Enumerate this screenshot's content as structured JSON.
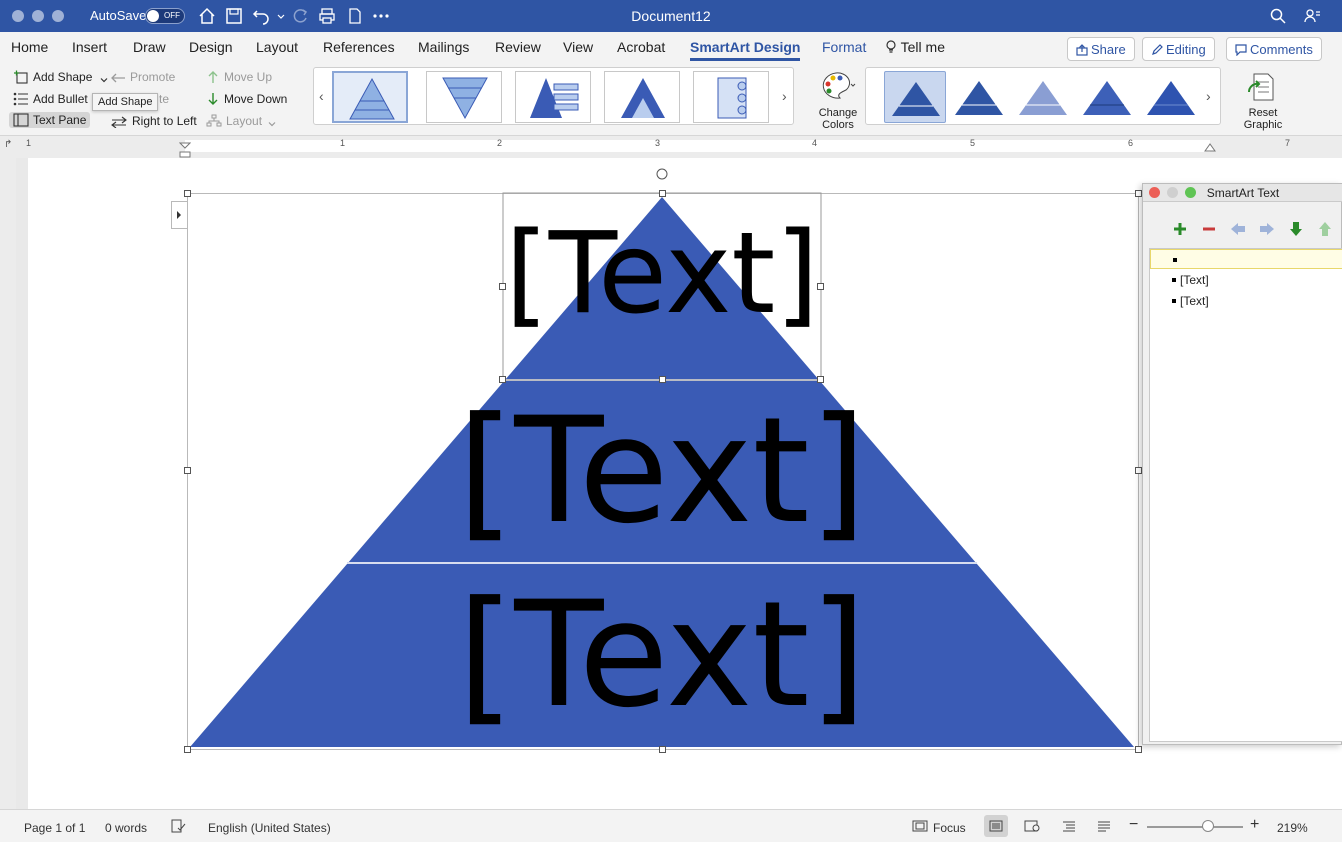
{
  "titlebar": {
    "autosave_label": "AutoSave",
    "autosave_state": "OFF",
    "document_title": "Document12"
  },
  "tabs": [
    "Home",
    "Insert",
    "Draw",
    "Design",
    "Layout",
    "References",
    "Mailings",
    "Review",
    "View",
    "Acrobat",
    "SmartArt Design",
    "Format"
  ],
  "tell_me": "Tell me",
  "buttons": {
    "share": "Share",
    "editing": "Editing",
    "comments": "Comments"
  },
  "ribbon": {
    "add_shape": "Add Shape",
    "add_bullet": "Add Bullet",
    "text_pane": "Text Pane",
    "promote": "Promote",
    "demote_fragment": "te",
    "right_to_left": "Right to Left",
    "move_up": "Move Up",
    "move_down": "Move Down",
    "layout": "Layout",
    "change_colors": "Change Colors",
    "change_colors_line1": "Change",
    "change_colors_line2": "Colors",
    "reset_graphic_line1": "Reset",
    "reset_graphic_line2": "Graphic",
    "tooltip": "Add Shape"
  },
  "ruler": {
    "numbers": [
      "1",
      "1",
      "2",
      "3",
      "4",
      "5",
      "6",
      "7"
    ]
  },
  "smartart": {
    "shapes": [
      "[Text]",
      "[Text]",
      "[Text]"
    ],
    "fill_color": "#3a5bb5"
  },
  "text_pane": {
    "title": "SmartArt Text",
    "items": [
      "",
      "[Text]",
      "[Text]"
    ]
  },
  "status": {
    "page": "Page 1 of 1",
    "words": "0 words",
    "language": "English (United States)",
    "focus": "Focus",
    "zoom": "219%"
  },
  "colors": {
    "titlebar": "#2f55a4",
    "accent": "#2f55a4",
    "pyramid": "#3a5bb5"
  }
}
